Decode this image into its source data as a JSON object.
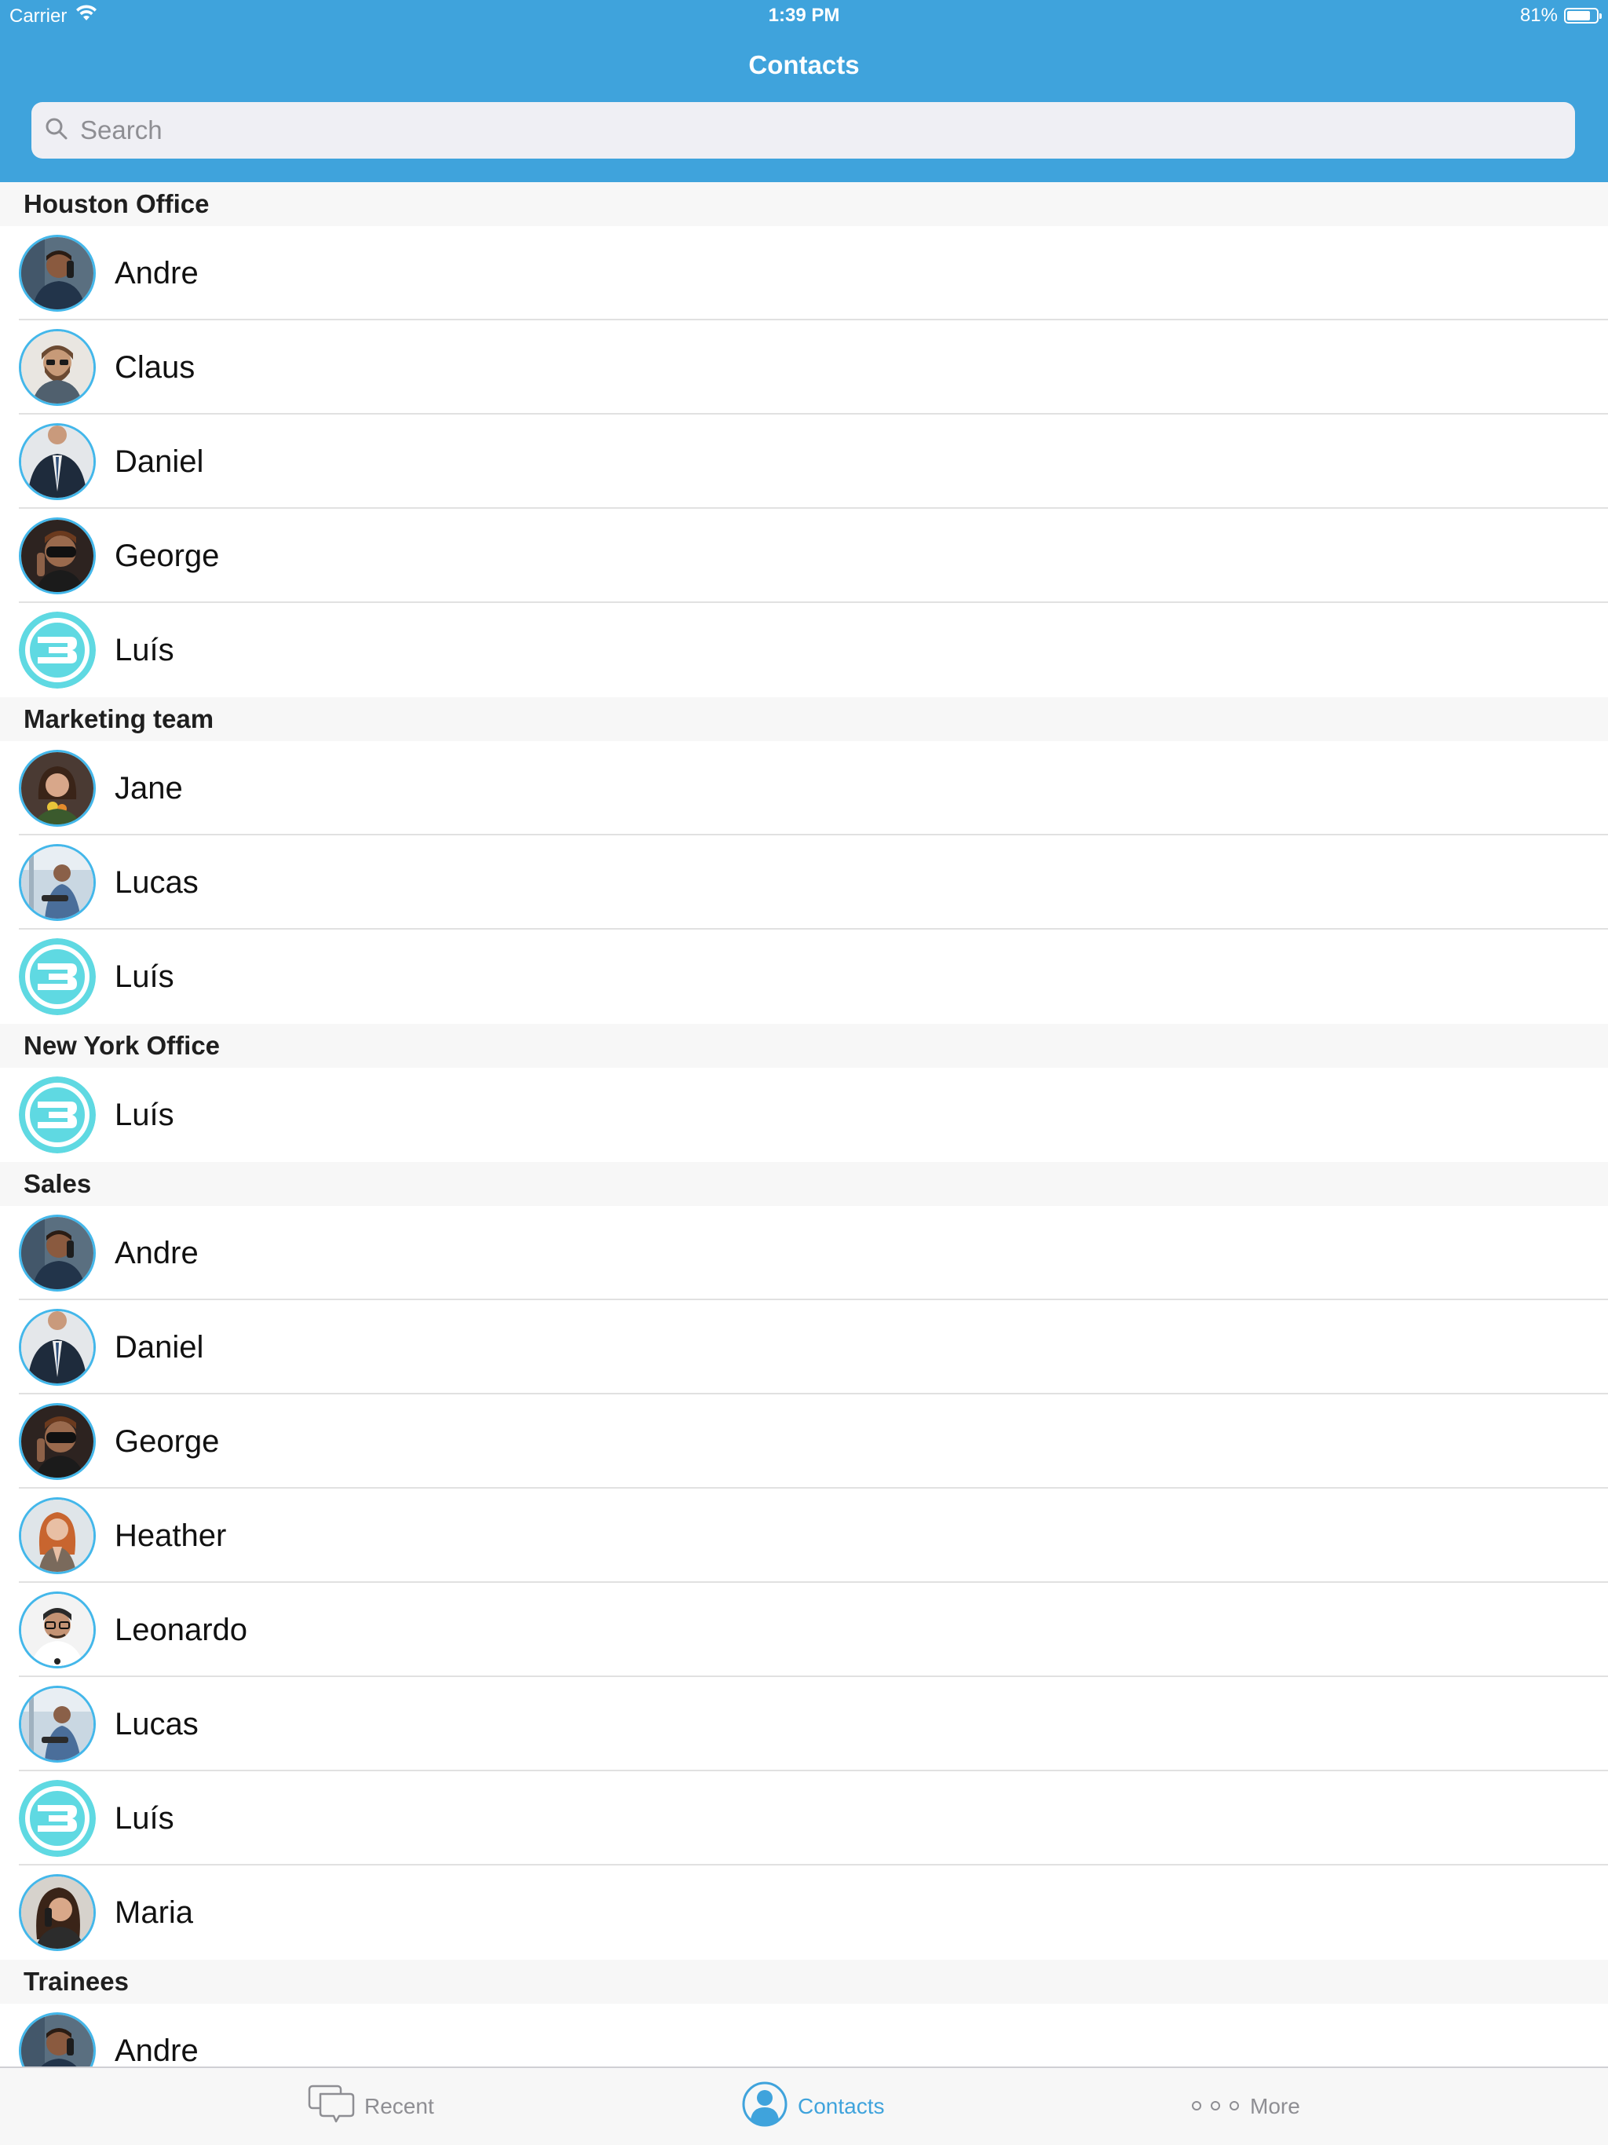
{
  "status_bar": {
    "carrier": "Carrier",
    "time": "1:39 PM",
    "battery_percent": "81%",
    "battery_level": 0.81
  },
  "header": {
    "title": "Contacts",
    "search_placeholder": "Search"
  },
  "sections": [
    {
      "title": "Houston Office",
      "contacts": [
        {
          "name": "Andre",
          "avatar": "andre"
        },
        {
          "name": "Claus",
          "avatar": "claus"
        },
        {
          "name": "Daniel",
          "avatar": "daniel"
        },
        {
          "name": "George",
          "avatar": "george"
        },
        {
          "name": "Luís",
          "avatar": "logo"
        }
      ]
    },
    {
      "title": "Marketing team",
      "contacts": [
        {
          "name": "Jane",
          "avatar": "jane"
        },
        {
          "name": "Lucas",
          "avatar": "lucas"
        },
        {
          "name": "Luís",
          "avatar": "logo"
        }
      ]
    },
    {
      "title": "New York Office",
      "contacts": [
        {
          "name": "Luís",
          "avatar": "logo"
        }
      ]
    },
    {
      "title": "Sales",
      "contacts": [
        {
          "name": "Andre",
          "avatar": "andre"
        },
        {
          "name": "Daniel",
          "avatar": "daniel"
        },
        {
          "name": "George",
          "avatar": "george"
        },
        {
          "name": "Heather",
          "avatar": "heather"
        },
        {
          "name": "Leonardo",
          "avatar": "leonardo"
        },
        {
          "name": "Lucas",
          "avatar": "lucas"
        },
        {
          "name": "Luís",
          "avatar": "logo"
        },
        {
          "name": "Maria",
          "avatar": "maria"
        }
      ]
    },
    {
      "title": "Trainees",
      "contacts": [
        {
          "name": "Andre",
          "avatar": "andre"
        }
      ]
    }
  ],
  "tab_bar": {
    "recent": {
      "label": "Recent",
      "icon": "chat-bubbles-icon"
    },
    "contacts": {
      "label": "Contacts",
      "icon": "person-icon"
    },
    "more": {
      "label": "More",
      "icon": "more-dots-icon"
    }
  },
  "colors": {
    "accent": "#3fa3dc",
    "avatar_ring": "#43b7ea",
    "logo_fill": "#5fd9e2"
  }
}
